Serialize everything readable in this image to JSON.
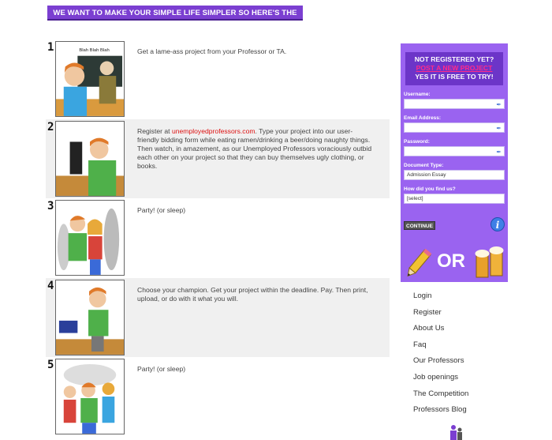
{
  "banner": {
    "text": "WE WANT TO MAKE YOUR SIMPLE LIFE SIMPLER SO HERE'S THE DEAL!"
  },
  "steps": [
    {
      "number": "1",
      "text": "Get a lame-ass project from your Professor or TA.",
      "art_caption": "Blah Blah Blah"
    },
    {
      "number": "2",
      "text_before": "Register at ",
      "link": "unemployedprofessors.com",
      "text_after": ". Type your project into our user-friendly bidding form while eating ramen/drinking a beer/doing naughty things. Then watch, in amazement, as our Unemployed Professors voraciously outbid each other on your project so that they can buy themselves ugly clothing, or books."
    },
    {
      "number": "3",
      "text": "Party! (or sleep)"
    },
    {
      "number": "4",
      "text": "Choose your champion. Get your project within the deadline. Pay. Then print, upload, or do with it what you will."
    },
    {
      "number": "5",
      "text": "Party! (or sleep)"
    }
  ],
  "signup": {
    "line1": "NOT REGISTERED YET?",
    "line2": "POST A NEW PROJECT",
    "line3": "YES IT IS FREE TO TRY!",
    "username_label": "Username:",
    "username_value": "",
    "email_label": "Email Address:",
    "email_value": "",
    "password_label": "Password:",
    "password_value": "",
    "doc_type_label": "Document Type:",
    "doc_type_value": "Admission Essay",
    "found_label": "How did you find us?",
    "found_value": "[select]",
    "continue_label": "CONTINUE",
    "info_glyph": "i",
    "or_text": "OR"
  },
  "nav": [
    "Login",
    "Register",
    "About Us",
    "Faq",
    "Our Professors",
    "Job openings",
    "The Competition",
    "Professors Blog"
  ],
  "colors": {
    "banner": "#7b3fd1",
    "panel": "#9a63f0",
    "panel_head": "#6c35c8",
    "link": "#dd1111",
    "highlight": "#ff2a8a"
  },
  "icons": [
    "key-icon",
    "info-icon",
    "pencil-icon",
    "beer-icon",
    "person-icon"
  ]
}
